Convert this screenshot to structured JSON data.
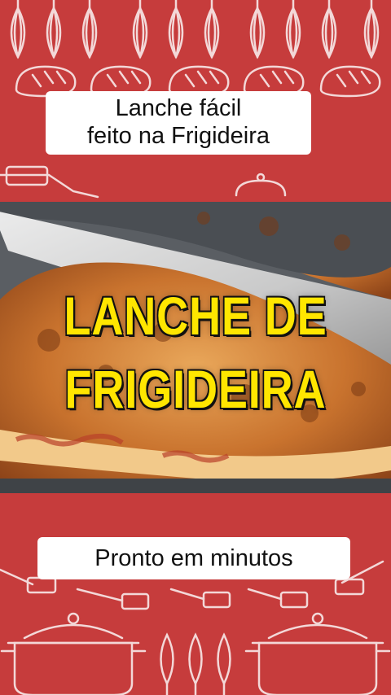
{
  "captions": {
    "top_line1": "Lanche fácil",
    "top_line2": "feito na Frigideira",
    "bottom": "Pronto em minutos"
  },
  "headline": {
    "line1": "LANCHE DE",
    "line2": "FRIGIDEIRA"
  },
  "colors": {
    "background": "#c63c3c",
    "headline_fill": "#ffe600",
    "caption_bg": "#ffffff"
  },
  "icons": [
    "whisk-icon",
    "bread-icon",
    "spatula-icon",
    "pot-icon",
    "sandwich-photo"
  ]
}
